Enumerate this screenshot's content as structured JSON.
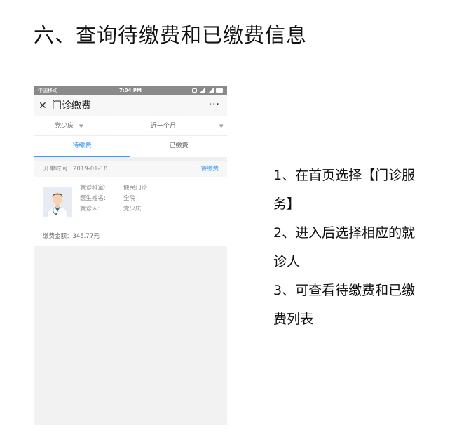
{
  "title": "六、查询待缴费和已缴费信息",
  "phone": {
    "status_bar": {
      "carrier": "中国移动",
      "time": "7:04 PM"
    },
    "navbar": {
      "close": "✕",
      "title": "门诊缴费",
      "more": "···"
    },
    "filters": {
      "patient": "党少庆",
      "period": "近一个月",
      "caret": "▼"
    },
    "tabs": [
      {
        "label": "待缴费",
        "active": true
      },
      {
        "label": "已缴费",
        "active": false
      }
    ],
    "order": {
      "date_label": "开单时间",
      "date": "2019-01-18",
      "status": "待缴费",
      "fields": [
        {
          "key": "就诊科室:",
          "value": "便民门诊"
        },
        {
          "key": "医生姓名:",
          "value": "全院"
        },
        {
          "key": "就诊人:",
          "value": "党少庆"
        }
      ],
      "amount": "缴费金额：345.77元"
    }
  },
  "instructions": [
    "1、在首页选择【门诊服",
    "务】",
    "2、进入后选择相应的就",
    "诊人",
    "3、可查看待缴费和已缴",
    "费列表"
  ],
  "colors": {
    "accent": "#3b9bff",
    "status_bar": "#8a8a8a"
  }
}
